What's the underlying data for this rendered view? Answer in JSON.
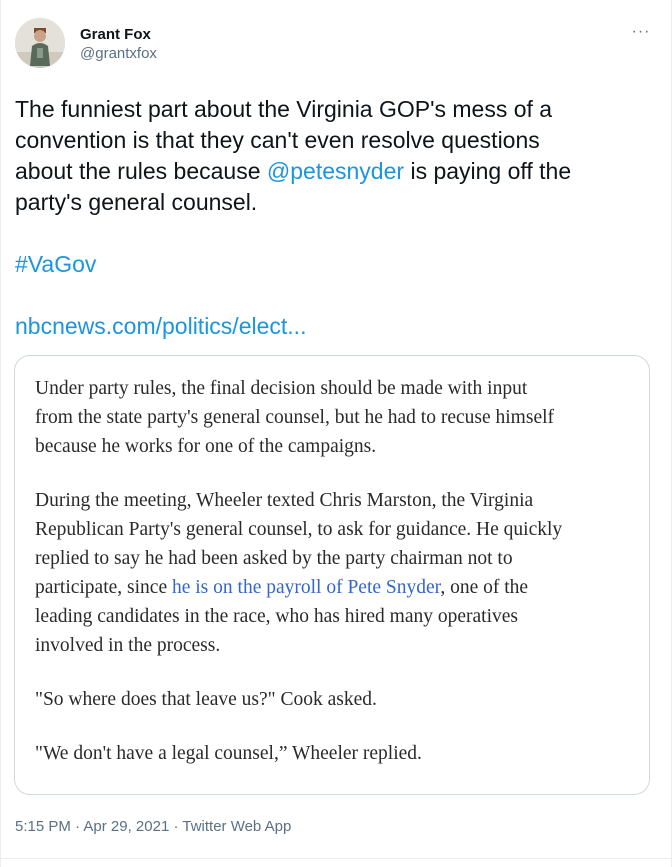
{
  "author": {
    "display_name": "Grant Fox",
    "handle": "@grantxfox"
  },
  "more_menu": "···",
  "tweet": {
    "line1": "The funniest part about the Virginia GOP's mess of a",
    "line2": "convention is that they can't even resolve questions",
    "line3_pre": "about the rules because ",
    "mention": "@petesnyder",
    "line3_post": " is paying off the",
    "line4": "party's general counsel.",
    "hashtag": "#VaGov",
    "url": "nbcnews.com/politics/elect..."
  },
  "card": {
    "p1": [
      "Under party rules, the final decision should be made with input",
      "from the state party's general counsel, but he had to recuse himself",
      "because he works for one of the campaigns."
    ],
    "p2_lines": [
      "During the meeting, Wheeler texted Chris Marston, the Virginia",
      "Republican Party's general counsel, to ask for guidance. He quickly",
      "replied to say he had been asked by the party chairman not to"
    ],
    "p2_line4_pre": "participate, since ",
    "p2_link": "he is on the payroll of Pete Snyder",
    "p2_line4_post": ", one of the",
    "p2_tail": [
      "leading candidates in the race, who has hired many operatives",
      "involved in the process."
    ],
    "p3": "\"So where does that leave us?\" Cook asked.",
    "p4": "\"We don't have a legal counsel,” Wheeler replied."
  },
  "meta": {
    "time": "5:15 PM",
    "separator": " · ",
    "date": "Apr 29, 2021",
    "source": "Twitter Web App"
  },
  "colors": {
    "link": "#1b95e0",
    "card_link": "#3366cc",
    "secondary_text": "#5b7083",
    "border": "#cfd9de"
  }
}
